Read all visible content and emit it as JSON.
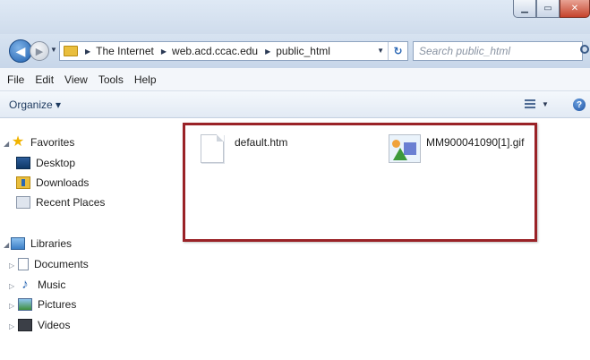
{
  "window": {
    "caption_buttons": [
      "minimize-icon",
      "maximize-icon",
      "close-icon"
    ]
  },
  "address": {
    "breadcrumbs": [
      "The Internet",
      "web.acd.ccac.edu",
      "public_html"
    ],
    "search_placeholder": "Search public_html"
  },
  "menu": {
    "items": [
      "File",
      "Edit",
      "View",
      "Tools",
      "Help"
    ]
  },
  "toolbar": {
    "organize_label": "Organize ▾"
  },
  "navigation": {
    "favorites_label": "Favorites",
    "favorites": [
      "Desktop",
      "Downloads",
      "Recent Places"
    ],
    "libraries_label": "Libraries",
    "libraries": [
      "Documents",
      "Music",
      "Pictures",
      "Videos"
    ]
  },
  "files": [
    {
      "name": "default.htm",
      "icon": "html-file-icon"
    },
    {
      "name": "MM900041090[1].gif",
      "icon": "gif-image-icon"
    }
  ],
  "colors": {
    "highlight_border": "#9a2227",
    "chrome_blue": "#cfdcec"
  }
}
